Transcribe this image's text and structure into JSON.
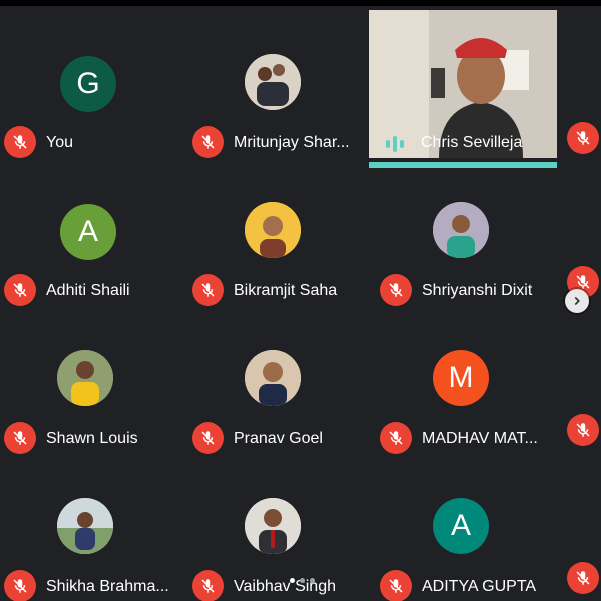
{
  "participants": [
    {
      "name": "You",
      "avatar_letter": "G",
      "avatar_color": "#0d5b45",
      "muted": true,
      "avatar_type": "letter"
    },
    {
      "name": "Mritunjay Shar...",
      "avatar_type": "photo",
      "muted": true
    },
    {
      "name": "Chris Sevilleja",
      "avatar_type": "video",
      "muted": false,
      "speaking": true
    },
    {
      "name": "Adhiti Shaili",
      "avatar_letter": "A",
      "avatar_color": "#689f38",
      "muted": true,
      "avatar_type": "letter"
    },
    {
      "name": "Bikramjit Saha",
      "avatar_type": "photo",
      "muted": true
    },
    {
      "name": "Shriyanshi Dixit",
      "avatar_type": "photo",
      "muted": true
    },
    {
      "name": "Shawn Louis",
      "avatar_type": "photo",
      "muted": true
    },
    {
      "name": "Pranav Goel",
      "avatar_type": "photo",
      "muted": true
    },
    {
      "name": "MADHAV MAT...",
      "avatar_letter": "M",
      "avatar_color": "#f4511e",
      "muted": true,
      "avatar_type": "letter"
    },
    {
      "name": "Shikha Brahma...",
      "avatar_type": "photo",
      "muted": true
    },
    {
      "name": "Vaibhav Singh",
      "avatar_type": "photo",
      "muted": true
    },
    {
      "name": "ADITYA GUPTA",
      "avatar_letter": "A",
      "avatar_color": "#00897b",
      "muted": true,
      "avatar_type": "letter"
    }
  ],
  "icons": {
    "mic_muted": "mic-off-icon",
    "next_page": "chevron-right-icon",
    "audio_level": "audio-level-icon"
  },
  "colors": {
    "background": "#202124",
    "mic_muted": "#ea4335",
    "speaking_indicator": "#5ecfc3"
  }
}
